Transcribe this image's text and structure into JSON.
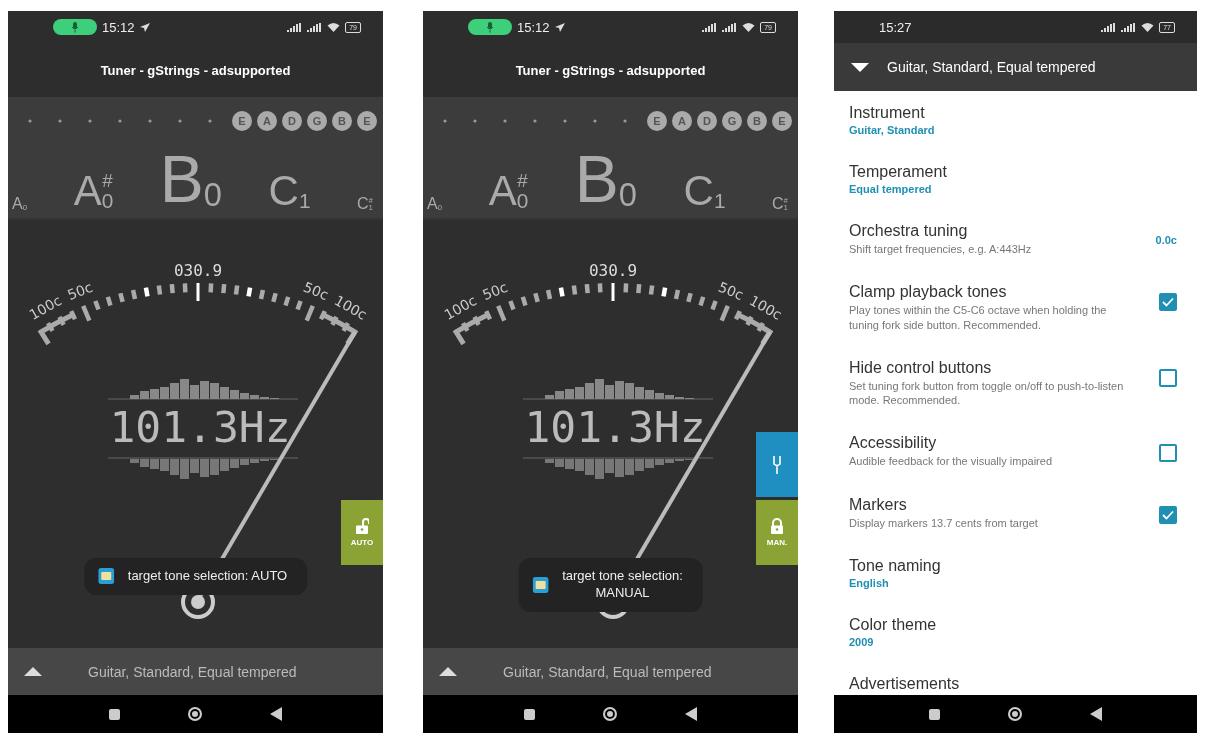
{
  "screens": [
    {
      "kind": "tuner",
      "status_bar": {
        "time": "15:12",
        "battery": "79",
        "mic_active": true
      },
      "title": "Tuner - gStrings - adsupported",
      "strings": [
        "E",
        "A",
        "D",
        "G",
        "B",
        "E"
      ],
      "notes": [
        {
          "name": "A",
          "octave": "0",
          "kind": "small"
        },
        {
          "name": "A",
          "accidental": "#",
          "octave": "0",
          "kind": "medium"
        },
        {
          "name": "B",
          "octave": "0",
          "kind": "large"
        },
        {
          "name": "C",
          "octave": "1",
          "kind": "medium"
        },
        {
          "name": "C",
          "accidental": "#",
          "octave": "1",
          "kind": "small"
        }
      ],
      "gauge": {
        "left_labels": [
          "100c",
          "50c"
        ],
        "right_labels": [
          "50c",
          "100c"
        ],
        "reading": "030.9",
        "frequency": "101.3Hz"
      },
      "fork_button": false,
      "mode_button": {
        "label": "AUTO",
        "locked": false
      },
      "toast": "target tone selection: AUTO",
      "bottom_bar": "Guitar, Standard, Equal tempered"
    },
    {
      "kind": "tuner",
      "status_bar": {
        "time": "15:12",
        "battery": "79",
        "mic_active": true
      },
      "title": "Tuner - gStrings - adsupported",
      "strings": [
        "E",
        "A",
        "D",
        "G",
        "B",
        "E"
      ],
      "notes": [
        {
          "name": "A",
          "octave": "0",
          "kind": "small"
        },
        {
          "name": "A",
          "accidental": "#",
          "octave": "0",
          "kind": "medium"
        },
        {
          "name": "B",
          "octave": "0",
          "kind": "large"
        },
        {
          "name": "C",
          "octave": "1",
          "kind": "medium"
        },
        {
          "name": "C",
          "accidental": "#",
          "octave": "1",
          "kind": "small"
        }
      ],
      "gauge": {
        "left_labels": [
          "100c",
          "50c"
        ],
        "right_labels": [
          "50c",
          "100c"
        ],
        "reading": "030.9",
        "frequency": "101.3Hz"
      },
      "fork_button": true,
      "mode_button": {
        "label": "MAN.",
        "locked": true
      },
      "toast": "target tone selection:\nMANUAL",
      "bottom_bar": "Guitar, Standard, Equal tempered"
    },
    {
      "kind": "settings",
      "status_bar": {
        "time": "15:27",
        "battery": "77",
        "mic_active": false
      },
      "header": "Guitar, Standard, Equal tempered",
      "items": [
        {
          "kind": "choice",
          "title": "Instrument",
          "summary": "Guitar, Standard"
        },
        {
          "kind": "choice",
          "title": "Temperament",
          "summary": "Equal tempered"
        },
        {
          "kind": "number",
          "title": "Orchestra tuning",
          "description": "Shift target frequencies, e.g. A:443Hz",
          "value": "0.0c"
        },
        {
          "kind": "toggle",
          "title": "Clamp playback tones",
          "description": "Play tones within the C5-C6 octave when holding the tuning fork side button. Recommended.",
          "checked": true
        },
        {
          "kind": "toggle",
          "title": "Hide control buttons",
          "description": "Set tuning fork button from toggle on/off to push-to-listen mode. Recommended.",
          "checked": false
        },
        {
          "kind": "toggle",
          "title": "Accessibility",
          "description": "Audible feedback for the visually impaired",
          "checked": false
        },
        {
          "kind": "toggle",
          "title": "Markers",
          "description": "Display markers 13.7 cents from target",
          "checked": true
        },
        {
          "kind": "choice",
          "title": "Tone naming",
          "summary": "English"
        },
        {
          "kind": "choice",
          "title": "Color theme",
          "summary": "2009"
        },
        {
          "kind": "choice",
          "title": "Advertisements"
        }
      ]
    }
  ]
}
